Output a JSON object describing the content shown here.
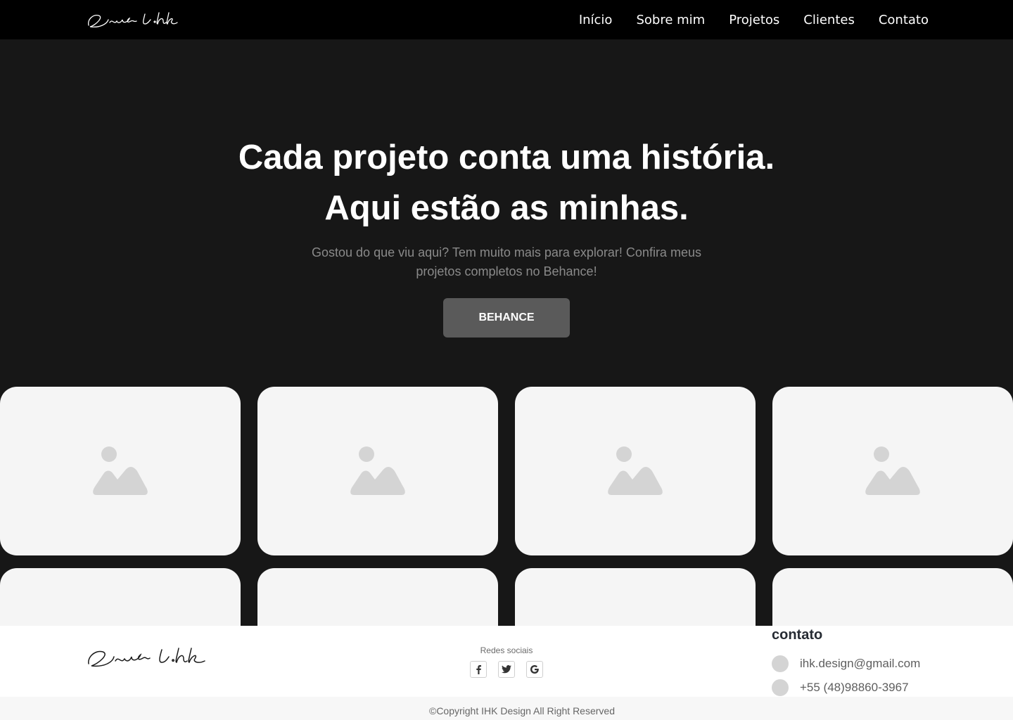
{
  "header": {
    "logo_alt": "Israel.hk",
    "nav": [
      "Início",
      "Sobre mim",
      "Projetos",
      "Clientes",
      "Contato"
    ]
  },
  "hero": {
    "title_line1": "Cada projeto conta uma história.",
    "title_line2": "Aqui estão as minhas.",
    "subtitle": "Gostou do que viu aqui? Tem muito mais para explorar! Confira meus projetos completos no Behance!",
    "cta_label": "BEHANCE"
  },
  "projects": {
    "count": 8
  },
  "footer": {
    "logo_alt": "Israel.hk",
    "social_title": "Redes sociais",
    "social_icons": [
      "facebook-icon",
      "twitter-icon",
      "google-icon"
    ],
    "contact_title": "contato",
    "email": "ihk.design@gmail.com",
    "phone": "+55 (48)98860-3967",
    "copyright": "©Copyright IHK Design All Right Reserved"
  },
  "colors": {
    "page_bg": "#171717",
    "nav_bg": "#000000",
    "cta_bg": "#5a5a5a",
    "card_bg": "#f5f5f5",
    "placeholder": "#d4d4d4"
  }
}
